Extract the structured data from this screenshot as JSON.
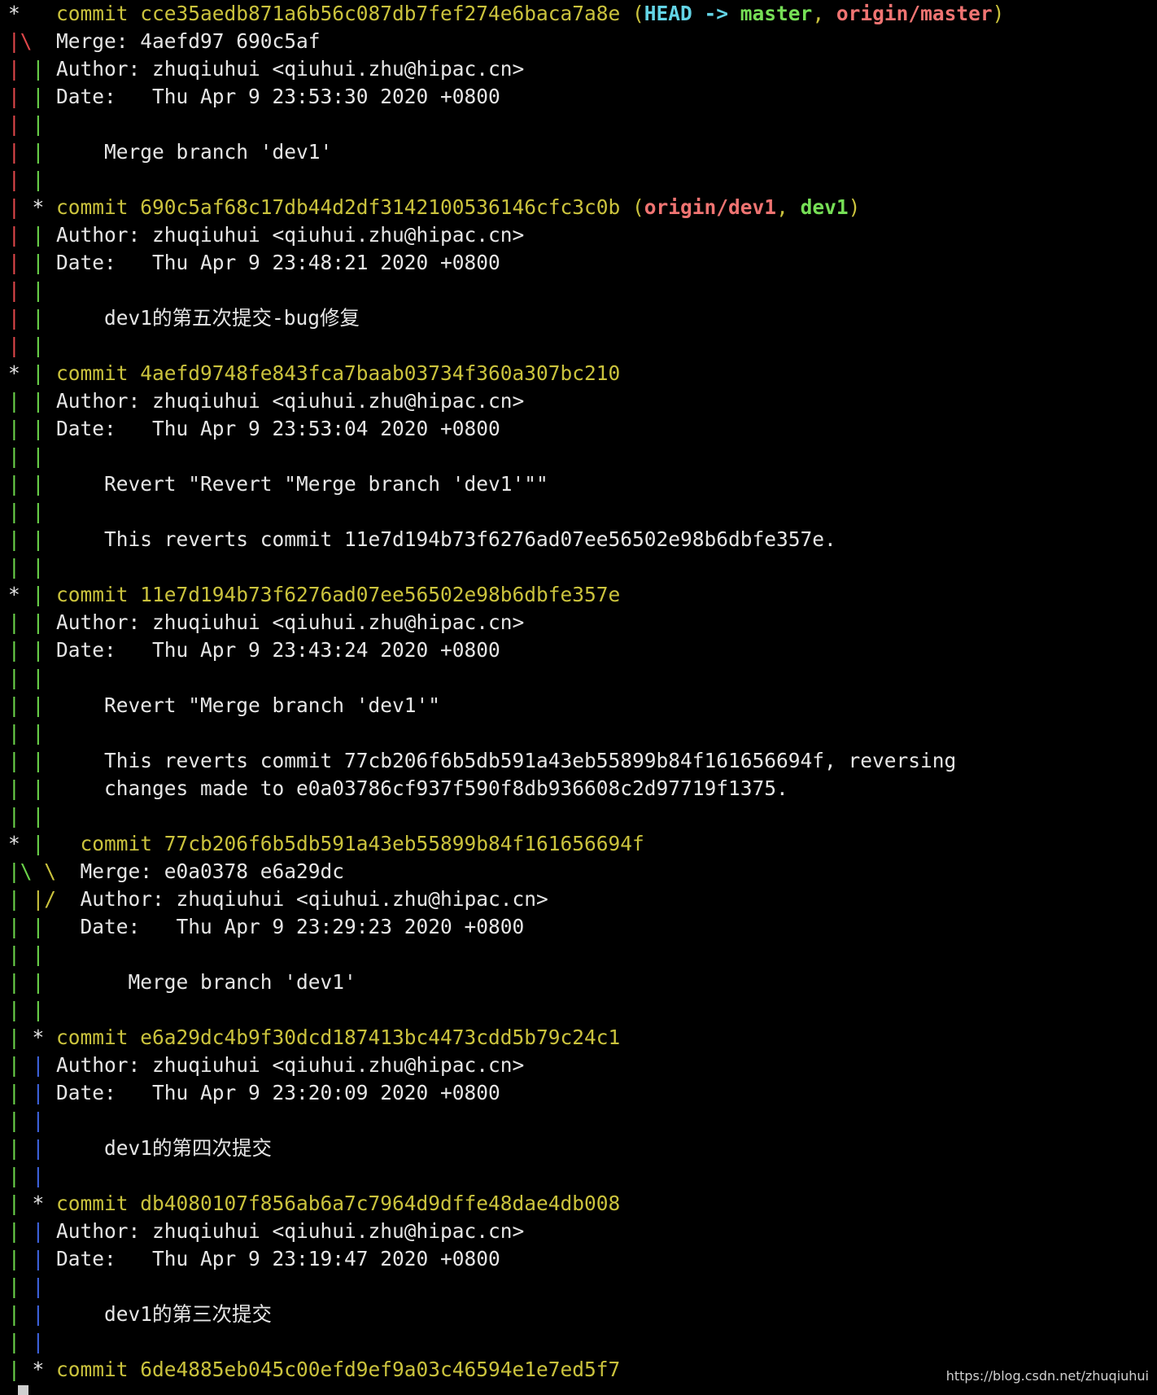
{
  "terminal": {
    "lines": [
      [
        [
          "*   ",
          "white"
        ],
        [
          "commit cce35aedb871a6b56c087db7fef274e6baca7a8e (",
          "yellow"
        ],
        [
          "HEAD -> ",
          "cyan-bold"
        ],
        [
          "master",
          "green-bold"
        ],
        [
          ", ",
          "yellow"
        ],
        [
          "origin/master",
          "red-bold"
        ],
        [
          ")",
          "yellow"
        ]
      ],
      [
        [
          "|\\",
          "red"
        ],
        [
          "  Merge: 4aefd97 690c5af",
          "white"
        ]
      ],
      [
        [
          "| ",
          "red"
        ],
        [
          "| ",
          "green"
        ],
        [
          "Author: zhuqiuhui <qiuhui.zhu@hipac.cn>",
          "white"
        ]
      ],
      [
        [
          "| ",
          "red"
        ],
        [
          "| ",
          "green"
        ],
        [
          "Date:   Thu Apr 9 23:53:30 2020 +0800",
          "white"
        ]
      ],
      [
        [
          "| ",
          "red"
        ],
        [
          "| ",
          "green"
        ]
      ],
      [
        [
          "| ",
          "red"
        ],
        [
          "| ",
          "green"
        ],
        [
          "    Merge branch 'dev1'",
          "white"
        ]
      ],
      [
        [
          "| ",
          "red"
        ],
        [
          "| ",
          "green"
        ]
      ],
      [
        [
          "| ",
          "red"
        ],
        [
          "* ",
          "white"
        ],
        [
          "commit 690c5af68c17db44d2df3142100536146cfc3c0b (",
          "yellow"
        ],
        [
          "origin/dev1",
          "red-bold"
        ],
        [
          ", ",
          "yellow"
        ],
        [
          "dev1",
          "green-bold"
        ],
        [
          ")",
          "yellow"
        ]
      ],
      [
        [
          "| ",
          "red"
        ],
        [
          "| ",
          "green"
        ],
        [
          "Author: zhuqiuhui <qiuhui.zhu@hipac.cn>",
          "white"
        ]
      ],
      [
        [
          "| ",
          "red"
        ],
        [
          "| ",
          "green"
        ],
        [
          "Date:   Thu Apr 9 23:48:21 2020 +0800",
          "white"
        ]
      ],
      [
        [
          "| ",
          "red"
        ],
        [
          "| ",
          "green"
        ]
      ],
      [
        [
          "| ",
          "red"
        ],
        [
          "| ",
          "green"
        ],
        [
          "    dev1的第五次提交-bug修复",
          "white"
        ]
      ],
      [
        [
          "| ",
          "red"
        ],
        [
          "| ",
          "green"
        ]
      ],
      [
        [
          "* ",
          "white"
        ],
        [
          "| ",
          "green"
        ],
        [
          "commit 4aefd9748fe843fca7baab03734f360a307bc210",
          "yellow"
        ]
      ],
      [
        [
          "| ",
          "green"
        ],
        [
          "| ",
          "green"
        ],
        [
          "Author: zhuqiuhui <qiuhui.zhu@hipac.cn>",
          "white"
        ]
      ],
      [
        [
          "| ",
          "green"
        ],
        [
          "| ",
          "green"
        ],
        [
          "Date:   Thu Apr 9 23:53:04 2020 +0800",
          "white"
        ]
      ],
      [
        [
          "| ",
          "green"
        ],
        [
          "| ",
          "green"
        ]
      ],
      [
        [
          "| ",
          "green"
        ],
        [
          "| ",
          "green"
        ],
        [
          "    Revert \"Revert \"Merge branch 'dev1'\"\"",
          "white"
        ]
      ],
      [
        [
          "| ",
          "green"
        ],
        [
          "| ",
          "green"
        ]
      ],
      [
        [
          "| ",
          "green"
        ],
        [
          "| ",
          "green"
        ],
        [
          "    This reverts commit 11e7d194b73f6276ad07ee56502e98b6dbfe357e.",
          "white"
        ]
      ],
      [
        [
          "| ",
          "green"
        ],
        [
          "| ",
          "green"
        ]
      ],
      [
        [
          "* ",
          "white"
        ],
        [
          "| ",
          "green"
        ],
        [
          "commit 11e7d194b73f6276ad07ee56502e98b6dbfe357e",
          "yellow"
        ]
      ],
      [
        [
          "| ",
          "green"
        ],
        [
          "| ",
          "green"
        ],
        [
          "Author: zhuqiuhui <qiuhui.zhu@hipac.cn>",
          "white"
        ]
      ],
      [
        [
          "| ",
          "green"
        ],
        [
          "| ",
          "green"
        ],
        [
          "Date:   Thu Apr 9 23:43:24 2020 +0800",
          "white"
        ]
      ],
      [
        [
          "| ",
          "green"
        ],
        [
          "| ",
          "green"
        ]
      ],
      [
        [
          "| ",
          "green"
        ],
        [
          "| ",
          "green"
        ],
        [
          "    Revert \"Merge branch 'dev1'\"",
          "white"
        ]
      ],
      [
        [
          "| ",
          "green"
        ],
        [
          "| ",
          "green"
        ]
      ],
      [
        [
          "| ",
          "green"
        ],
        [
          "| ",
          "green"
        ],
        [
          "    This reverts commit 77cb206f6b5db591a43eb55899b84f161656694f, reversing",
          "white"
        ]
      ],
      [
        [
          "| ",
          "green"
        ],
        [
          "| ",
          "green"
        ],
        [
          "    changes made to e0a03786cf937f590f8db936608c2d97719f1375.",
          "white"
        ]
      ],
      [
        [
          "| ",
          "green"
        ],
        [
          "| ",
          "green"
        ]
      ],
      [
        [
          "* ",
          "white"
        ],
        [
          "|   ",
          "green"
        ],
        [
          "commit 77cb206f6b5db591a43eb55899b84f161656694f",
          "yellow"
        ]
      ],
      [
        [
          "|\\ ",
          "green"
        ],
        [
          "\\  ",
          "yellow"
        ],
        [
          "Merge: e0a0378 e6a29dc",
          "white"
        ]
      ],
      [
        [
          "| ",
          "green"
        ],
        [
          "|/  ",
          "yellow"
        ],
        [
          "Author: zhuqiuhui <qiuhui.zhu@hipac.cn>",
          "white"
        ]
      ],
      [
        [
          "| ",
          "green"
        ],
        [
          "|   ",
          "green"
        ],
        [
          "Date:   Thu Apr 9 23:29:23 2020 +0800",
          "white"
        ]
      ],
      [
        [
          "| ",
          "green"
        ],
        [
          "| ",
          "green"
        ]
      ],
      [
        [
          "| ",
          "green"
        ],
        [
          "|   ",
          "green"
        ],
        [
          "    Merge branch 'dev1'",
          "white"
        ]
      ],
      [
        [
          "| ",
          "green"
        ],
        [
          "| ",
          "green"
        ]
      ],
      [
        [
          "| ",
          "green"
        ],
        [
          "* ",
          "white"
        ],
        [
          "commit e6a29dc4b9f30dcd187413bc4473cdd5b79c24c1",
          "yellow"
        ]
      ],
      [
        [
          "| ",
          "green"
        ],
        [
          "| ",
          "blue"
        ],
        [
          "Author: zhuqiuhui <qiuhui.zhu@hipac.cn>",
          "white"
        ]
      ],
      [
        [
          "| ",
          "green"
        ],
        [
          "| ",
          "blue"
        ],
        [
          "Date:   Thu Apr 9 23:20:09 2020 +0800",
          "white"
        ]
      ],
      [
        [
          "| ",
          "green"
        ],
        [
          "| ",
          "blue"
        ]
      ],
      [
        [
          "| ",
          "green"
        ],
        [
          "| ",
          "blue"
        ],
        [
          "    dev1的第四次提交",
          "white"
        ]
      ],
      [
        [
          "| ",
          "green"
        ],
        [
          "| ",
          "blue"
        ]
      ],
      [
        [
          "| ",
          "green"
        ],
        [
          "* ",
          "white"
        ],
        [
          "commit db4080107f856ab6a7c7964d9dffe48dae4db008",
          "yellow"
        ]
      ],
      [
        [
          "| ",
          "green"
        ],
        [
          "| ",
          "blue"
        ],
        [
          "Author: zhuqiuhui <qiuhui.zhu@hipac.cn>",
          "white"
        ]
      ],
      [
        [
          "| ",
          "green"
        ],
        [
          "| ",
          "blue"
        ],
        [
          "Date:   Thu Apr 9 23:19:47 2020 +0800",
          "white"
        ]
      ],
      [
        [
          "| ",
          "green"
        ],
        [
          "| ",
          "blue"
        ]
      ],
      [
        [
          "| ",
          "green"
        ],
        [
          "| ",
          "blue"
        ],
        [
          "    dev1的第三次提交",
          "white"
        ]
      ],
      [
        [
          "| ",
          "green"
        ],
        [
          "| ",
          "blue"
        ]
      ],
      [
        [
          "| ",
          "green"
        ],
        [
          "* ",
          "white"
        ],
        [
          "commit 6de4885eb045c00efd9ef9a03c46594e1e7ed5f7",
          "yellow"
        ]
      ]
    ]
  },
  "colors": {
    "background": "#000000",
    "commit_hash": "#cbc33d",
    "head": "#63d4e6",
    "local_branch": "#76df56",
    "remote_branch": "#f07472",
    "graph_red": "#e0474a",
    "graph_green": "#6bd34a",
    "graph_blue": "#3f64e0"
  },
  "watermark": "https://blog.csdn.net/zhuqiuhui"
}
